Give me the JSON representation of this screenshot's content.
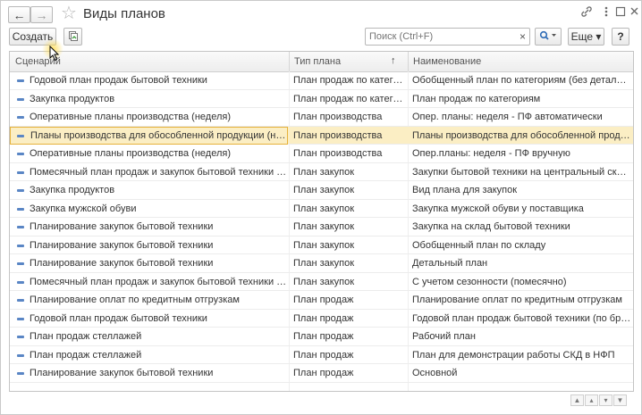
{
  "window": {
    "title": "Виды планов",
    "nav_back": "🡐",
    "nav_forward": "🡒"
  },
  "toolbar": {
    "create_label": "Создать",
    "search_placeholder": "Поиск (Ctrl+F)",
    "search_clear": "×",
    "find_label": "🔍 ▾",
    "more_label": "Еще ▾",
    "help_label": "?"
  },
  "table": {
    "columns": [
      "Сценарий",
      "Тип плана",
      "Наименование"
    ],
    "sort_indicator": "↑",
    "rows": [
      [
        "Годовой план продаж бытовой техники",
        "План продаж по категориям",
        "Обобщенный план по категориям (без детализации)"
      ],
      [
        "Закупка продуктов",
        "План продаж по категориям",
        "План продаж по категориям"
      ],
      [
        "Оперативные планы производства (неделя)",
        "План производства",
        "Опер. планы: неделя - ПФ автоматически"
      ],
      [
        "Планы производства для обособленной продукции (неделя)",
        "План производства",
        "Планы производства для обособленной продукции(нед)"
      ],
      [
        "Оперативные планы производства (неделя)",
        "План производства",
        "Опер.планы: неделя - ПФ вручную"
      ],
      [
        "Помесячный план продаж и закупок бытовой техники (с учетом сезонности)",
        "План закупок",
        "Закупки бытовой техники на центральный склад"
      ],
      [
        "Закупка продуктов",
        "План закупок",
        "Вид плана для закупок"
      ],
      [
        "Закупка мужской обуви",
        "План закупок",
        "Закупка мужской обуви у поставщика"
      ],
      [
        "Планирование закупок бытовой техники",
        "План закупок",
        "Закупка на склад бытовой техники"
      ],
      [
        "Планирование закупок бытовой техники",
        "План закупок",
        "Обобщенный план по складу"
      ],
      [
        "Планирование закупок бытовой техники",
        "План закупок",
        "Детальный план"
      ],
      [
        "Помесячный план продаж и закупок бытовой техники (с учетом сезонности)",
        "План закупок",
        "С учетом сезонности (помесячно)"
      ],
      [
        "Планирование оплат по кредитным отгрузкам",
        "План продаж",
        "Планирование оплат по кредитным отгрузкам"
      ],
      [
        "Годовой план продаж бытовой техники",
        "План продаж",
        "Годовой план продаж бытовой техники (по брендам)"
      ],
      [
        "План продаж стеллажей",
        "План продаж",
        "Рабочий план"
      ],
      [
        "План продаж стеллажей",
        "План продаж",
        "План для демонстрации работы СКД в НФП"
      ],
      [
        "Планирование закупок бытовой техники",
        "План продаж",
        "Основной"
      ]
    ],
    "selected_row_index": 3
  },
  "pager": {
    "first": "⏶",
    "prev": "▴",
    "next": "▾",
    "last": "⏷"
  },
  "icons": {
    "star": "star-icon",
    "link": "link-icon",
    "menu": "more-vertical-icon",
    "maximize": "maximize-icon",
    "close": "close-icon"
  },
  "colors": {
    "selected_row": "#fbeec4",
    "selected_border": "#e6b23b",
    "row_icon": "#5a86c5"
  }
}
